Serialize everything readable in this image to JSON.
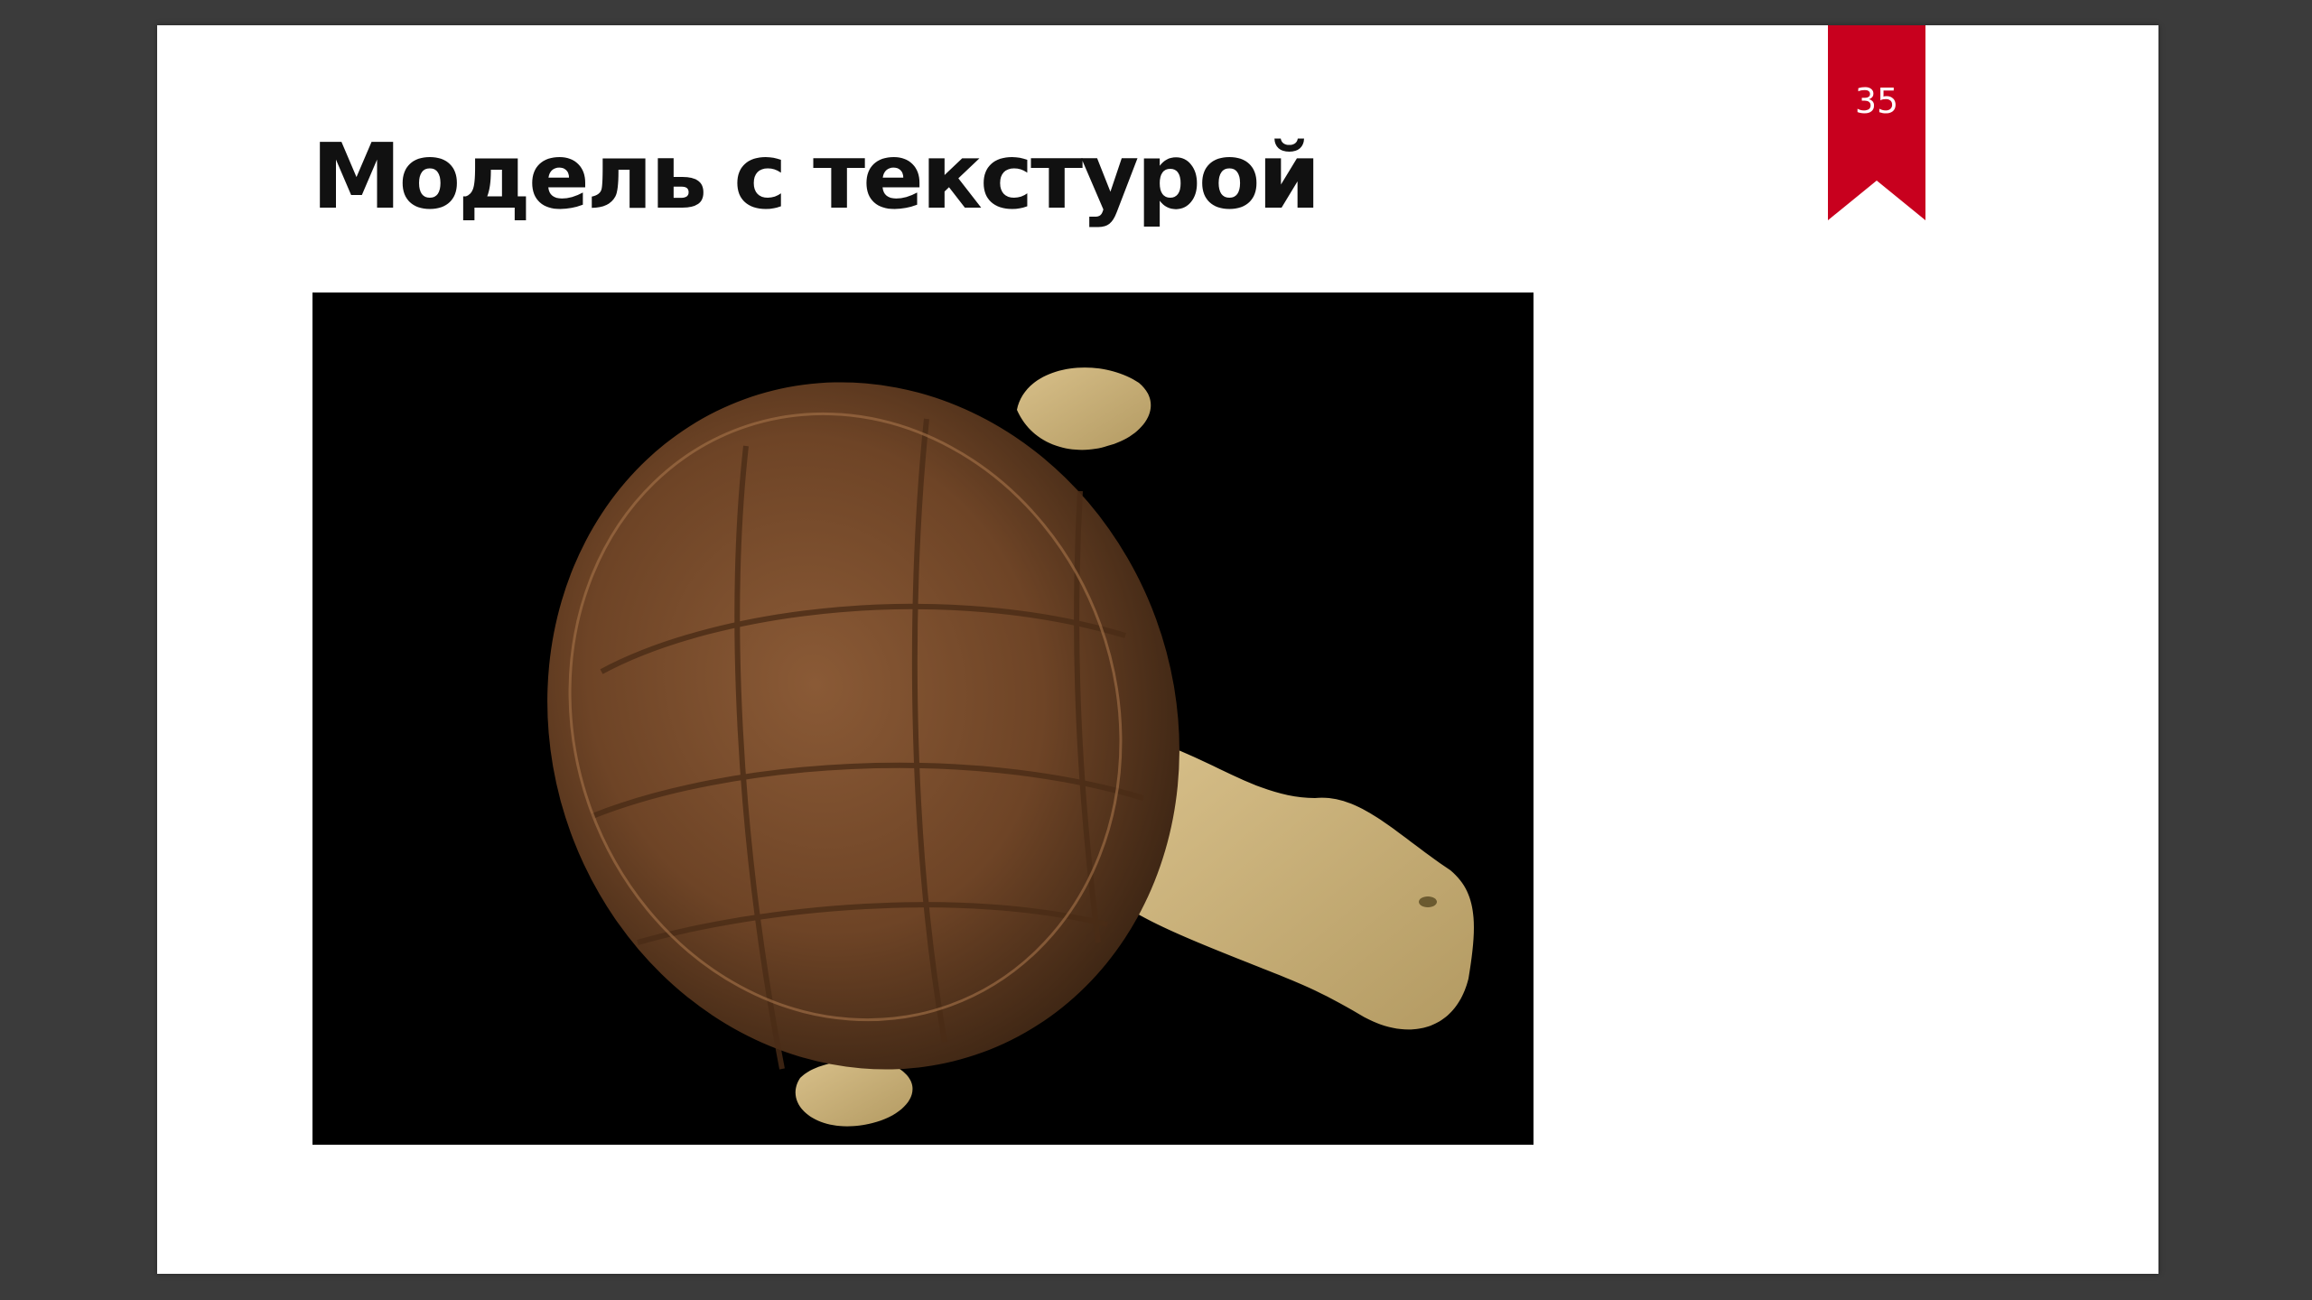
{
  "slide": {
    "title": "Модель с текстурой",
    "page_number": "35"
  },
  "figure": {
    "subject": "turtle-model-icon"
  },
  "colors": {
    "background_frame": "#3b3b3b",
    "slide_background": "#ffffff",
    "ribbon": "#c8001e",
    "figure_background": "#000000",
    "shell": "#7a4a2a",
    "skin": "#cdb47c"
  }
}
